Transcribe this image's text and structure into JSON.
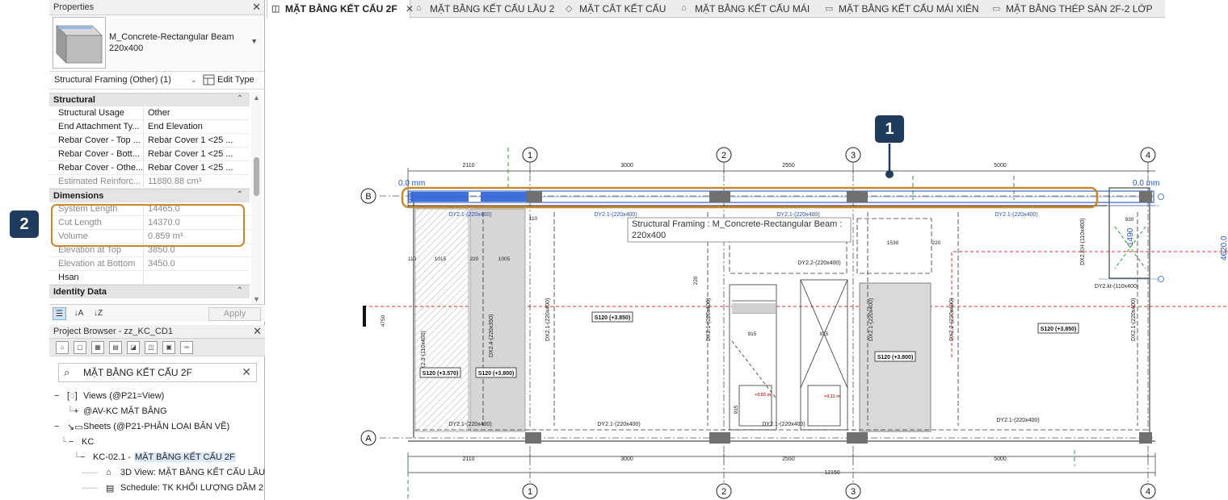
{
  "properties": {
    "title": "Properties",
    "type_name_line1": "M_Concrete-Rectangular Beam",
    "type_name_line2": "220x400",
    "instance_filter": "Structural Framing (Other) (1)",
    "edit_type": "Edit Type",
    "groups": {
      "structural": "Structural",
      "dimensions": "Dimensions",
      "identity": "Identity Data"
    },
    "structural_rows": [
      {
        "k": "Structural Usage",
        "v": "Other"
      },
      {
        "k": "End Attachment Ty...",
        "v": "End Elevation"
      },
      {
        "k": "Rebar Cover - Top ...",
        "v": "Rebar Cover 1 <25 ..."
      },
      {
        "k": "Rebar Cover - Bott...",
        "v": "Rebar Cover 1 <25 ..."
      },
      {
        "k": "Rebar Cover - Othe...",
        "v": "Rebar Cover 1 <25 ..."
      },
      {
        "k": "Estimated Reinforc...",
        "v": "11880.88 cm³"
      }
    ],
    "dimension_rows": [
      {
        "k": "System Length",
        "v": "14465.0"
      },
      {
        "k": "Cut Length",
        "v": "14370.0"
      },
      {
        "k": "Volume",
        "v": "0.859 m³"
      },
      {
        "k": "Elevation at Top",
        "v": "3850.0"
      },
      {
        "k": "Elevation at Bottom",
        "v": "3450.0"
      },
      {
        "k": "Hsan",
        "v": ""
      }
    ],
    "apply": "Apply"
  },
  "browser": {
    "title": "Project Browser - zz_KC_CD1",
    "search_value": "MẶT BẰNG KẾT CẤU 2F",
    "tree": {
      "views": "Views (@P21=View)",
      "av_kc": "@AV-KC MẶT BẰNG",
      "sheets": "Sheets (@P21-PHÂN LOẠI BẢN VẼ)",
      "kc": "KC",
      "sheet_prefix": "KC-02.1 - ",
      "sheet_hl": "MẶT BẰNG KẾT CẤU 2F",
      "view3d": "3D View: MẶT BẰNG KẾT CẤU LẦU",
      "schedule": "Schedule: TK KHỐI LƯỢNG DẦM 2"
    }
  },
  "tabs": [
    {
      "label": "MẶT BẰNG KẾT CẤU 2F",
      "icon": "floorplan-icon"
    },
    {
      "label": "MẶT BẰNG KẾT CẤU LẦU 2",
      "icon": "floorplan-icon"
    },
    {
      "label": "MẶT CẮT KẾT CẤU",
      "icon": "section-icon"
    },
    {
      "label": "MẶT BẰNG KẾT CẤU MÁI",
      "icon": "floorplan-icon"
    },
    {
      "label": "MẶT BẰNG KẾT CẤU MÁI XIÊN",
      "icon": "sheet-icon"
    },
    {
      "label": "MẶT BẰNG THÉP SÀN 2F-2 LỚP",
      "icon": "sheet-icon"
    }
  ],
  "drawing": {
    "grids": [
      "1",
      "2",
      "3",
      "4"
    ],
    "rows": [
      "B",
      "A"
    ],
    "top_dims": [
      "2110",
      "3000",
      "2550",
      "5000"
    ],
    "bottom_dims": [
      "2110",
      "3000",
      "2550",
      "5000"
    ],
    "total_dim": "12150",
    "offset_left": "0.0 mm",
    "offset_right": "0.0 mm",
    "tooltip_line1": "Structural Framing : M_Concrete-Rectangular Beam :",
    "tooltip_line2": "220x400",
    "beam_label": "DY2.1-(220x400)",
    "beam_label_2": "DY2.2-(220x400)",
    "beam_label_kt": "DY2.kt-(110x400)",
    "col_labels": [
      "DX2.3-(110x400)",
      "DX2.4-(220x350)",
      "DX2.1-(220x400)",
      "DX2.1-(220x400)",
      "DX2.1-(220x400)",
      "DX2.2-(220x400)",
      "DX2.1-(220x400)",
      "DX2.KH-(110x400)"
    ],
    "slabs": [
      "S120 (+3.570)",
      "S120 (+3.800)",
      "S120 (+3.850)",
      "S120 (+3.800)",
      "S120 (+3.850)"
    ],
    "small_dims": [
      "110",
      "1015",
      "220",
      "1005",
      "110",
      "1530",
      "220",
      "930",
      "915",
      "915",
      "4750",
      "1490",
      "220",
      "915"
    ],
    "levels": [
      "+0.55 m",
      "+0.11 m"
    ],
    "right_readout": "4620.0",
    "callout_1": "1",
    "callout_2": "2"
  },
  "colors": {
    "callout_orange": "#c8862e",
    "badge_navy": "#1f3b5e",
    "beam_blue": "#3f6fd8",
    "select_blue": "#3a64c8"
  }
}
